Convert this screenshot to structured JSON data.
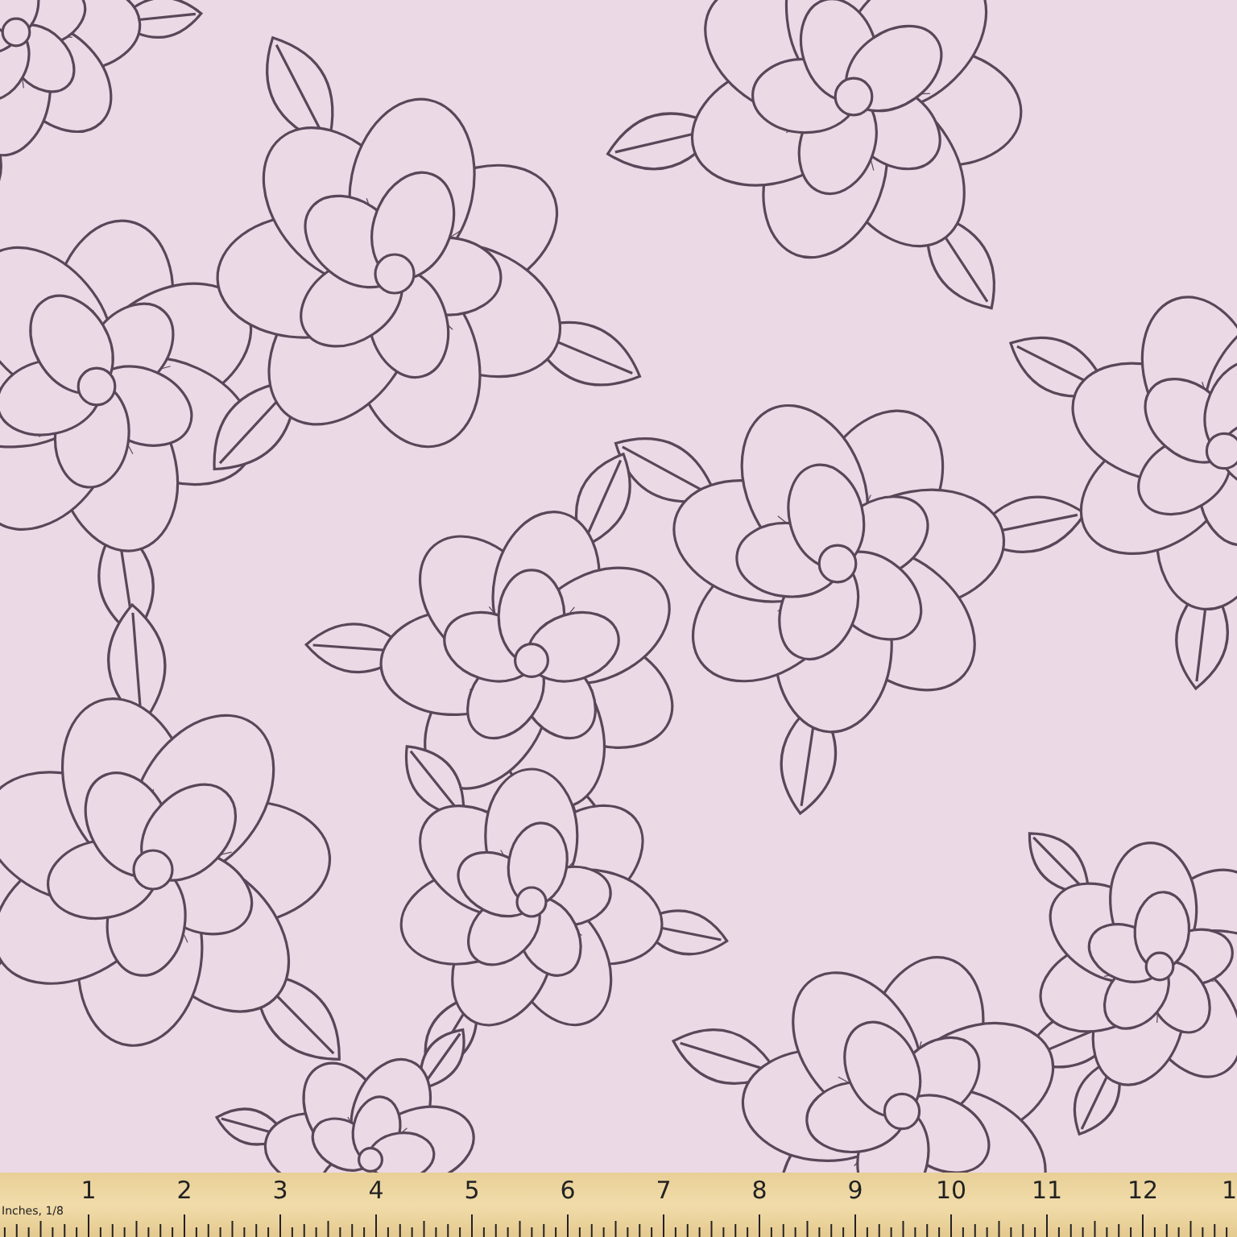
{
  "ruler": {
    "unit_label": "Inches, 1/8",
    "numbers": [
      "1",
      "2",
      "3",
      "4",
      "5",
      "6",
      "7",
      "8",
      "9",
      "10",
      "11",
      "12",
      "1"
    ]
  }
}
